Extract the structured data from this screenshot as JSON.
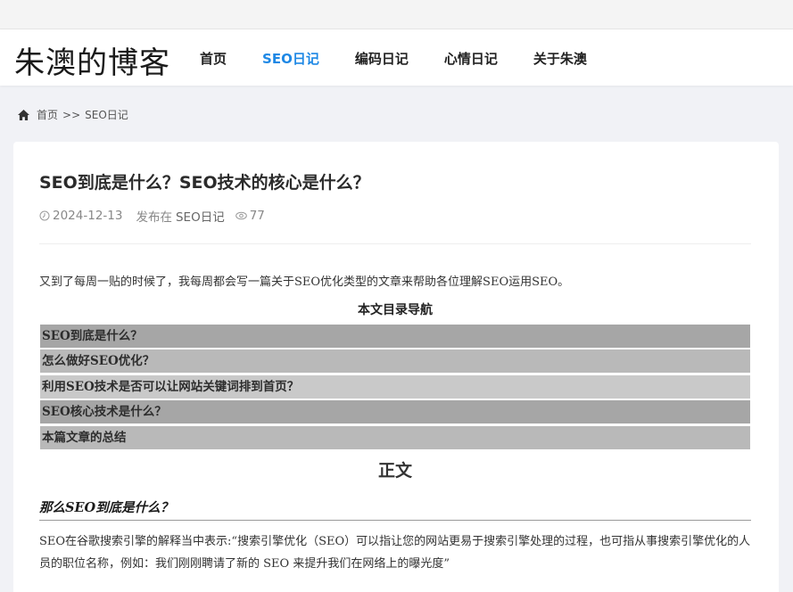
{
  "site": {
    "logo": "朱澳的博客"
  },
  "nav": {
    "items": [
      {
        "label": "首页",
        "active": false
      },
      {
        "label": "SEO日记",
        "active": true
      },
      {
        "label": "编码日记",
        "active": false
      },
      {
        "label": "心情日记",
        "active": false
      },
      {
        "label": "关于朱澳",
        "active": false
      }
    ],
    "active_color": "#1e88e5"
  },
  "breadcrumb": {
    "icon": "home-icon",
    "home": "首页",
    "separator": ">>",
    "current": "SEO日记"
  },
  "article": {
    "title": "SEO到底是什么？SEO技术的核心是什么？",
    "date": "2024-12-13",
    "category_prefix": "发布在",
    "category": "SEO日记",
    "views": "77",
    "intro": "又到了每周一贴的时候了，我每周都会写一篇关于SEO优化类型的文章来帮助各位理解SEO运用SEO。",
    "toc_title": "本文目录导航",
    "toc": [
      "SEO到底是什么？",
      "怎么做好SEO优化？",
      "利用SEO技术是否可以让网站关键词排到首页？",
      "SEO核心技术是什么？",
      "本篇文章的总结"
    ],
    "body_title": "正文",
    "section1_heading": "那么SEO到底是什么？",
    "section1_para": "SEO在谷歌搜索引擎的解释当中表示:“搜索引擎优化（SEO）可以指让您的网站更易于搜索引擎处理的过程，也可指从事搜索引擎优化的人员的职位名称，例如：我们刚刚聘请了新的 SEO 来提升我们在网络上的曝光度”"
  }
}
